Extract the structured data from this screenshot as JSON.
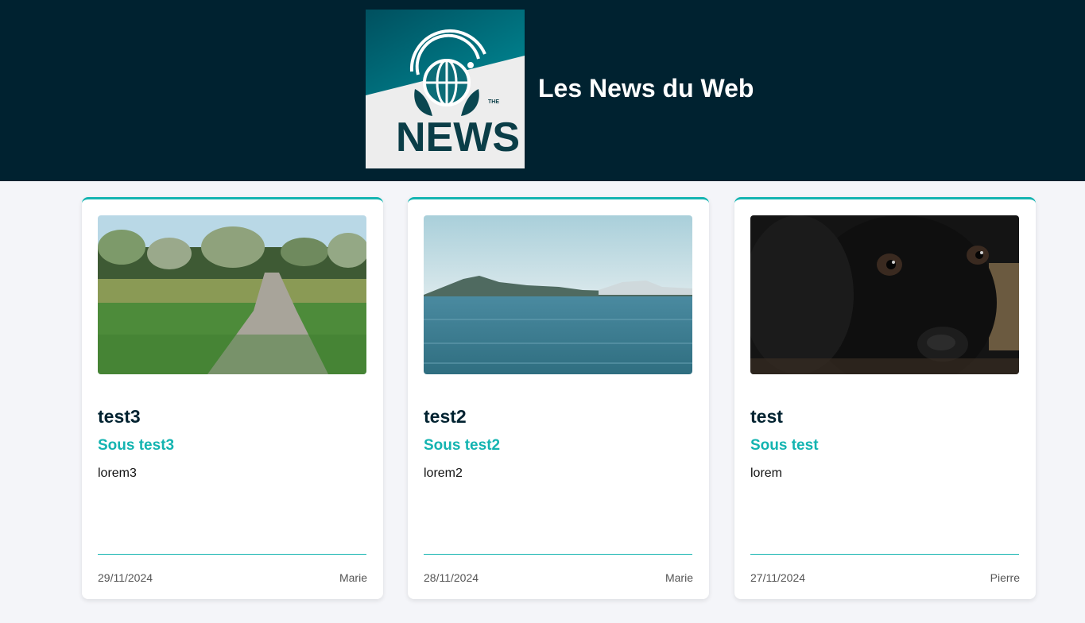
{
  "header": {
    "site_title": "Les News du Web",
    "logo_text": "NEWS",
    "logo_superscript": "THE",
    "background": "#002230",
    "accent": "#14b4b1"
  },
  "articles": [
    {
      "title": "test3",
      "subtitle": "Sous test3",
      "body": "lorem3",
      "date": "29/11/2024",
      "author": "Marie",
      "image": "path-through-grass-photo"
    },
    {
      "title": "test2",
      "subtitle": "Sous test2",
      "body": "lorem2",
      "date": "28/11/2024",
      "author": "Marie",
      "image": "sea-and-island-photo"
    },
    {
      "title": "test",
      "subtitle": "Sous test",
      "body": "lorem",
      "date": "27/11/2024",
      "author": "Pierre",
      "image": "black-puppy-photo"
    }
  ]
}
